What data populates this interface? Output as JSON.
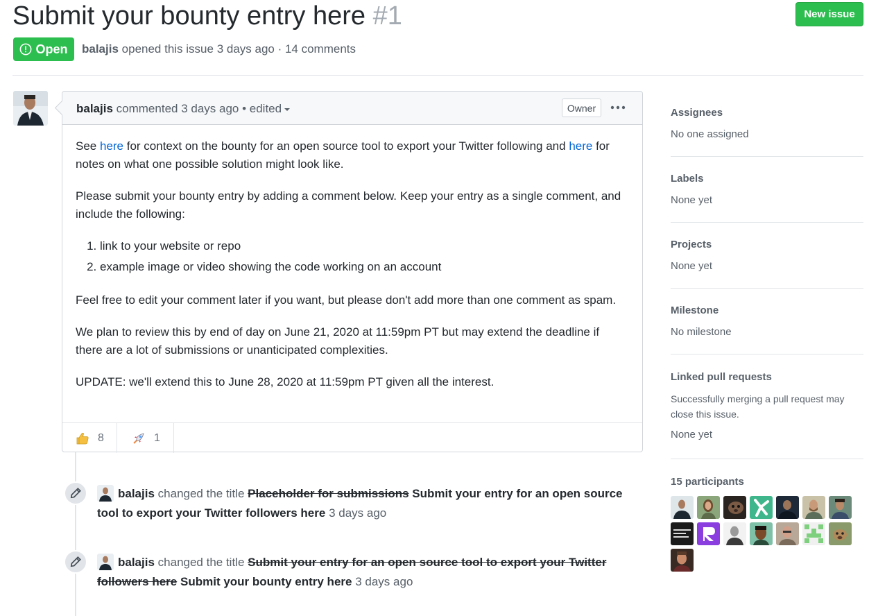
{
  "issue": {
    "title": "Submit your bounty entry here",
    "number": "#1",
    "state": "Open",
    "author": "balajis",
    "opened_text": "opened this issue 3 days ago · 14 comments"
  },
  "toolbar": {
    "new_issue_label": "New issue"
  },
  "comment": {
    "author": "balajis",
    "action": "commented 3 days ago • edited",
    "role": "Owner",
    "body": {
      "p1_a": "See ",
      "p1_link1": "here",
      "p1_b": " for context on the bounty for an open source tool to export your Twitter following and ",
      "p1_link2": "here",
      "p1_c": " for notes on what one possible solution might look like.",
      "p2": "Please submit your bounty entry by adding a comment below. Keep your entry as a single comment, and include the following:",
      "list": [
        "link to your website or repo",
        "example image or video showing the code working on an account"
      ],
      "p3": "Feel free to edit your comment later if you want, but please don't add more than one comment as spam.",
      "p4": "We plan to review this by end of day on June 21, 2020 at 11:59pm PT but may extend the deadline if there are a lot of submissions or unanticipated complexities.",
      "p5": "UPDATE: we'll extend this to June 28, 2020 at 11:59pm PT given all the interest."
    },
    "reactions": [
      {
        "icon": "thumbs-up-icon",
        "count": "8"
      },
      {
        "icon": "rocket-icon",
        "count": "1"
      }
    ]
  },
  "events": [
    {
      "actor": "balajis",
      "action": "changed the title",
      "old_title": "Placeholder for submissions",
      "new_title": "Submit your entry for an open source tool to export your Twitter followers here",
      "time": "3 days ago"
    },
    {
      "actor": "balajis",
      "action": "changed the title",
      "old_title": "Submit your entry for an open source tool to export your Twitter followers here",
      "new_title": "Submit your bounty entry here",
      "time": "3 days ago"
    }
  ],
  "sidebar": {
    "assignees": {
      "title": "Assignees",
      "value": "No one assigned"
    },
    "labels": {
      "title": "Labels",
      "value": "None yet"
    },
    "projects": {
      "title": "Projects",
      "value": "None yet"
    },
    "milestone": {
      "title": "Milestone",
      "value": "No milestone"
    },
    "linked_prs": {
      "title": "Linked pull requests",
      "note": "Successfully merging a pull request may close this issue.",
      "value": "None yet"
    },
    "participants": {
      "title": "15 participants"
    }
  },
  "colors": {
    "open_green": "#2cbe4e",
    "link_blue": "#0366d6",
    "muted_text": "#586069"
  }
}
